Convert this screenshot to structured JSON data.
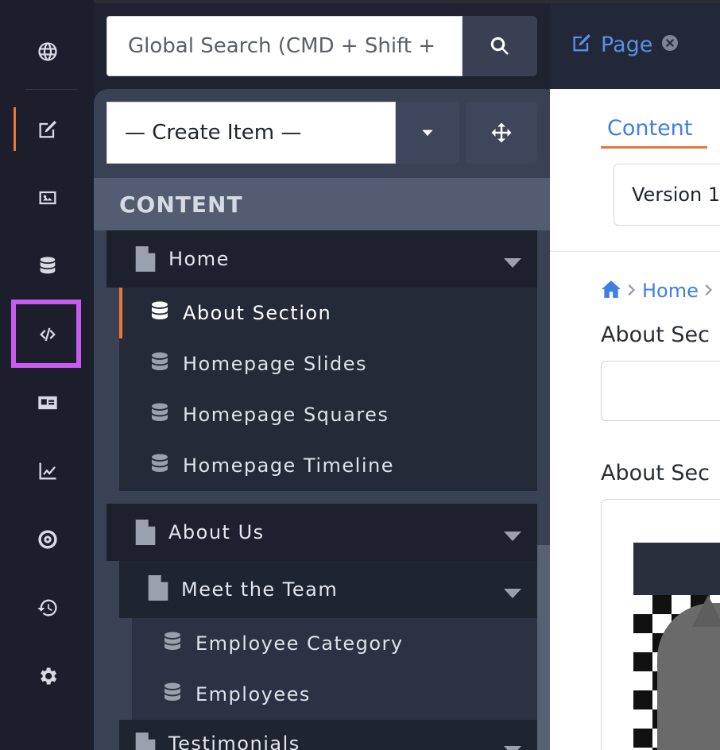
{
  "search": {
    "placeholder": "Global Search (CMD + Shift +"
  },
  "top_tab": {
    "label": "Page"
  },
  "create": {
    "label": "— Create Item —"
  },
  "nav": {
    "heading": "CONTENT",
    "groups": [
      {
        "label": "Home",
        "items": [
          "About Section",
          "Homepage Slides",
          "Homepage Squares",
          "Homepage Timeline"
        ],
        "active_item": "About Section"
      },
      {
        "label": "About Us",
        "subgroups": [
          {
            "label": "Meet the Team",
            "items": [
              "Employee Category",
              "Employees"
            ]
          }
        ]
      },
      {
        "label": "Testimonials"
      }
    ]
  },
  "editor": {
    "tab": "Content",
    "version": "Version 1",
    "breadcrumb": {
      "home": "Home"
    },
    "field1_label": "About Sec",
    "field2_label": "About Sec"
  },
  "rail_icons": [
    "globe-icon",
    "edit-icon",
    "image-icon",
    "database-icon",
    "code-icon",
    "id-card-icon",
    "chart-line-icon",
    "target-icon",
    "history-icon",
    "gear-icon"
  ],
  "colors": {
    "accent_orange": "#e8763a",
    "link_blue": "#3f7fe0",
    "highlight": "#c85cf0"
  }
}
